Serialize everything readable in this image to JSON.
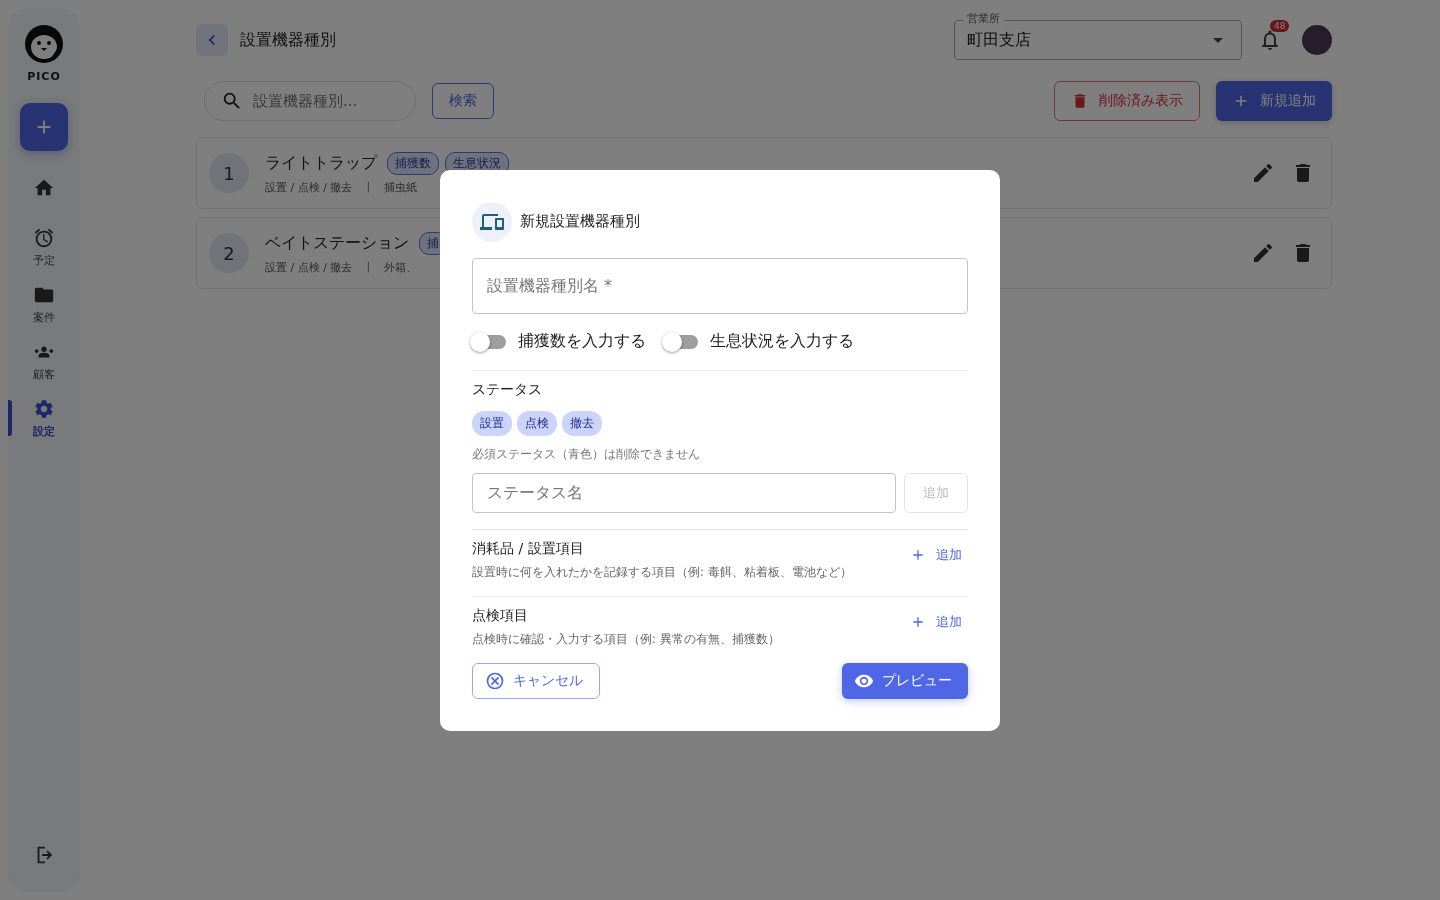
{
  "sidebar": {
    "logo_text": "PICO",
    "items": [
      {
        "kind": "home",
        "selected": false
      },
      {
        "kind": "alarm",
        "label": "予定",
        "selected": false
      },
      {
        "kind": "folder",
        "label": "案件",
        "selected": false
      },
      {
        "kind": "group",
        "label": "顧客",
        "selected": false
      },
      {
        "kind": "gear",
        "label": "設定",
        "selected": true
      }
    ]
  },
  "header": {
    "title": "設置機器種別",
    "branch_select": {
      "label": "営業所",
      "value": "町田支店"
    },
    "notification_count": "48"
  },
  "toolbar": {
    "search": {
      "placeholder": "設置機器種別..."
    },
    "search_button": "検索",
    "show_deleted_button": "削除済み表示",
    "add_button": "新規追加"
  },
  "list": [
    {
      "number": "1",
      "name": "ライトトラップ",
      "tags": [
        "捕獲数",
        "生息状況"
      ],
      "statuses": "設置 / 点検 / 撤去",
      "separator": "|",
      "detail": "捕虫紙"
    },
    {
      "number": "2",
      "name": "ベイトステーション",
      "tags": [
        "捕"
      ],
      "statuses": "設置 / 点検 / 撤去",
      "separator": "|",
      "detail": "外箱、"
    }
  ],
  "dialog": {
    "title": "新規設置機器種別",
    "name_field": {
      "placeholder": "設置機器種別名 *"
    },
    "toggles": [
      {
        "label": "捕獲数を入力する",
        "on": false
      },
      {
        "label": "生息状況を入力する",
        "on": false
      }
    ],
    "status_heading": "ステータス",
    "status_chips": [
      "設置",
      "点検",
      "撤去"
    ],
    "status_note": "必須ステータス（青色）は削除できません",
    "status_field": {
      "placeholder": "ステータス名"
    },
    "status_add_button": {
      "label": "追加",
      "disabled": true
    },
    "sections": [
      {
        "title": "消耗品 / 設置項目",
        "description": "設置時に何を入れたかを記録する項目（例: 毒餌、粘着板、電池など）",
        "add_label": "追加"
      },
      {
        "title": "点検項目",
        "description": "点検時に確認・入力する項目（例: 異常の有無、捕獲数）",
        "add_label": "追加"
      }
    ],
    "cancel_button": "キャンセル",
    "preview_button": "プレビュー"
  }
}
